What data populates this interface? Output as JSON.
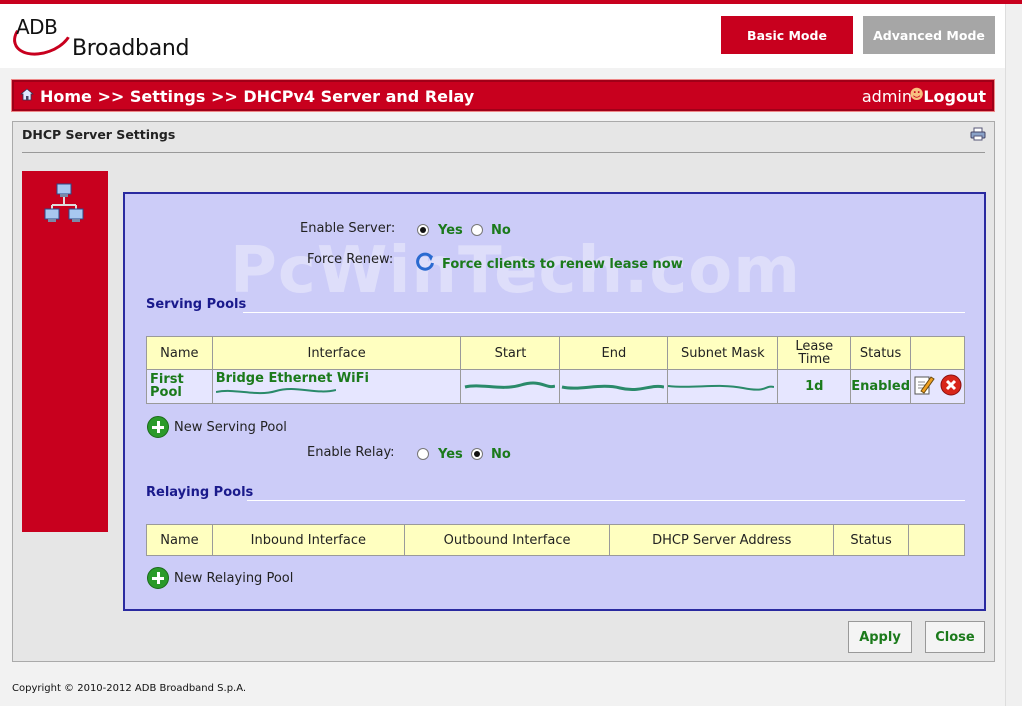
{
  "brand": {
    "line1": "ADB",
    "line2": "Broadband"
  },
  "modes": {
    "basic": "Basic Mode",
    "advanced": "Advanced Mode"
  },
  "nav": {
    "breadcrumb": "Home >> Settings >> DHCPv4 Server and Relay",
    "user": "admin",
    "logout": "Logout"
  },
  "panel": {
    "title": "DHCP Server Settings"
  },
  "watermark": "PcWinTech.com",
  "server": {
    "enable_label": "Enable Server:",
    "yes": "Yes",
    "no": "No",
    "enabled": "yes",
    "force_renew_label": "Force Renew:",
    "force_renew_action": "Force clients to renew lease now"
  },
  "serving_pools": {
    "title": "Serving Pools",
    "columns": [
      "Name",
      "Interface",
      "Start",
      "End",
      "Subnet Mask",
      "Lease Time",
      "Status"
    ],
    "rows": [
      {
        "name": "First Pool",
        "interface": "Bridge Ethernet WiFi",
        "lease_time": "1d",
        "status": "Enabled"
      }
    ],
    "new_label": "New Serving Pool"
  },
  "relay": {
    "enable_label": "Enable Relay:",
    "yes": "Yes",
    "no": "No",
    "enabled": "no"
  },
  "relaying_pools": {
    "title": "Relaying Pools",
    "columns": [
      "Name",
      "Inbound Interface",
      "Outbound Interface",
      "DHCP Server Address",
      "Status"
    ],
    "new_label": "New Relaying Pool"
  },
  "buttons": {
    "apply": "Apply",
    "close": "Close"
  },
  "footer": "Copyright © 2010-2012 ADB Broadband S.p.A.",
  "colors": {
    "brand_red": "#c8001e",
    "content_bg": "#ccccf8",
    "header_cell": "#ffffc0",
    "green_text": "#1b7a1b"
  }
}
